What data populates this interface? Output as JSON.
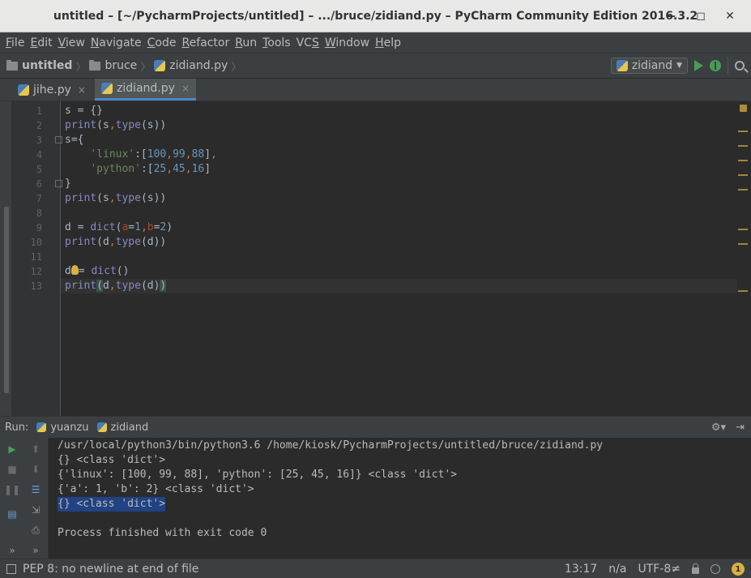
{
  "window": {
    "title": "untitled – [~/PycharmProjects/untitled] – .../bruce/zidiand.py – PyCharm Community Edition 2016.3.2",
    "controls": [
      "‒",
      "◻",
      "✕"
    ]
  },
  "menu": [
    {
      "label": "File",
      "mnemonic": "F",
      "rest": "ile"
    },
    {
      "label": "Edit",
      "mnemonic": "E",
      "rest": "dit"
    },
    {
      "label": "View",
      "mnemonic": "V",
      "rest": "iew"
    },
    {
      "label": "Navigate",
      "mnemonic": "N",
      "rest": "avigate"
    },
    {
      "label": "Code",
      "mnemonic": "C",
      "rest": "ode"
    },
    {
      "label": "Refactor",
      "mnemonic": "R",
      "rest": "efactor"
    },
    {
      "label": "Run",
      "mnemonic": "R",
      "rest": "un"
    },
    {
      "label": "Tools",
      "mnemonic": "T",
      "rest": "ools"
    },
    {
      "label": "VCS",
      "mnemonic": "S",
      "rest": "VC"
    },
    {
      "label": "Window",
      "mnemonic": "W",
      "rest": "indow"
    },
    {
      "label": "Help",
      "mnemonic": "H",
      "rest": "elp"
    }
  ],
  "breadcrumb": {
    "project": "untitled",
    "folder": "bruce",
    "file": "zidiand.py"
  },
  "run_config": {
    "name": "zidiand"
  },
  "tabs": [
    {
      "label": "jihe.py",
      "active": false
    },
    {
      "label": "zidiand.py",
      "active": true
    }
  ],
  "editor": {
    "line_numbers": [
      "1",
      "2",
      "3",
      "4",
      "5",
      "6",
      "7",
      "8",
      "9",
      "10",
      "11",
      "12",
      "13"
    ],
    "cursor_line": 13
  },
  "run": {
    "label": "Run:",
    "tabs": [
      "yuanzu",
      "zidiand"
    ],
    "console": [
      "/usr/local/python3/bin/python3.6 /home/kiosk/PycharmProjects/untitled/bruce/zidiand.py",
      "{} <class 'dict'>",
      "{'linux': [100, 99, 88], 'python': [25, 45, 16]} <class 'dict'>",
      "{'a': 1, 'b': 2} <class 'dict'>",
      "{} <class 'dict'>",
      "",
      "Process finished with exit code 0"
    ],
    "selected_line": 4
  },
  "status": {
    "message": "PEP 8: no newline at end of file",
    "position": "13:17",
    "line_sep": "n/a",
    "encoding": "UTF-8≠",
    "notifications": "1"
  }
}
